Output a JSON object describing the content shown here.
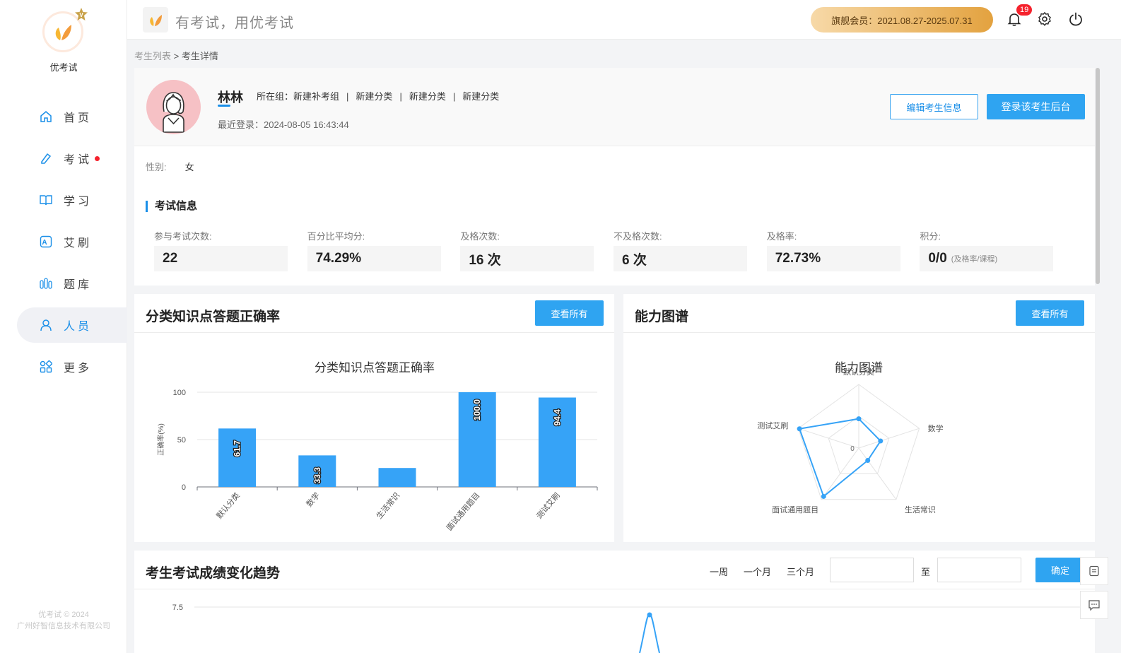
{
  "brand": {
    "name": "优考试",
    "copyright_line1": "优考试 © 2024",
    "copyright_line2": "广州好智信息技术有限公司"
  },
  "nav": {
    "items": [
      {
        "label": "首页",
        "icon": "home-icon"
      },
      {
        "label": "考试",
        "icon": "exam-icon"
      },
      {
        "label": "学习",
        "icon": "book-icon"
      },
      {
        "label": "艾刷",
        "icon": "brush-icon"
      },
      {
        "label": "题库",
        "icon": "question-bank-icon"
      },
      {
        "label": "人员",
        "icon": "user-icon"
      },
      {
        "label": "更多",
        "icon": "apps-icon"
      }
    ]
  },
  "header": {
    "slogan": "有考试，用优考试",
    "vip_text": "旗舰会员：2021.08.27-2025.07.31",
    "notification_count": "19"
  },
  "breadcrumb": {
    "parent": "考生列表",
    "separator": " > ",
    "current": "考生详情"
  },
  "profile": {
    "name": "林林",
    "groups_label": "所在组：",
    "groups": [
      "新建补考组",
      "新建分类",
      "新建分类",
      "新建分类"
    ],
    "separator": "|",
    "last_login": "最近登录：2024-08-05 16:43:44",
    "edit_button": "编辑考生信息",
    "login_button": "登录该考生后台",
    "gender_label": "性别:",
    "gender_value": "女"
  },
  "exam_info": {
    "title": "考试信息",
    "stats": [
      {
        "label": "参与考试次数:",
        "value": "22",
        "note": ""
      },
      {
        "label": "百分比平均分:",
        "value": "74.29%",
        "note": ""
      },
      {
        "label": "及格次数:",
        "value": "16 次",
        "note": ""
      },
      {
        "label": "不及格次数:",
        "value": "6 次",
        "note": ""
      },
      {
        "label": "及格率:",
        "value": "72.73%",
        "note": ""
      },
      {
        "label": "积分:",
        "value": "0/0",
        "note": "(及格率/课程)"
      }
    ]
  },
  "panels": {
    "accuracy": {
      "title": "分类知识点答题正确率",
      "button": "查看所有"
    },
    "ability": {
      "title": "能力图谱",
      "button": "查看所有"
    },
    "trend": {
      "title": "考生考试成绩变化趋势",
      "ranges": [
        "一周",
        "一个月",
        "三个月"
      ],
      "to_label": "至",
      "confirm": "确定"
    }
  },
  "chart_data": [
    {
      "type": "bar",
      "title": "分类知识点答题正确率",
      "ylabel": "正确率(%)",
      "categories": [
        "默认分类",
        "数学",
        "生活常识",
        "面试通用题目",
        "测试艾刷"
      ],
      "values": [
        61.7,
        33.3,
        20,
        100.0,
        94.4
      ],
      "value_labels": [
        "61.7",
        "33.3",
        "",
        "100.0",
        "94.4"
      ],
      "ylim": [
        0,
        100
      ],
      "yticks": [
        "0",
        "50",
        "100"
      ],
      "color": "#36a3f7"
    },
    {
      "type": "radar",
      "title": "能力图谱",
      "indicators": [
        "默认分类",
        "数学",
        "生活常识",
        "面试通用题目",
        "测试艾刷"
      ],
      "values": [
        0.46,
        0.36,
        0.24,
        0.94,
        0.98
      ],
      "center_label": "0",
      "color": "#36a3f7"
    },
    {
      "type": "line",
      "title": "考生考试成绩变化趋势",
      "ytick_visible": "7.5",
      "color": "#36a3f7"
    }
  ]
}
